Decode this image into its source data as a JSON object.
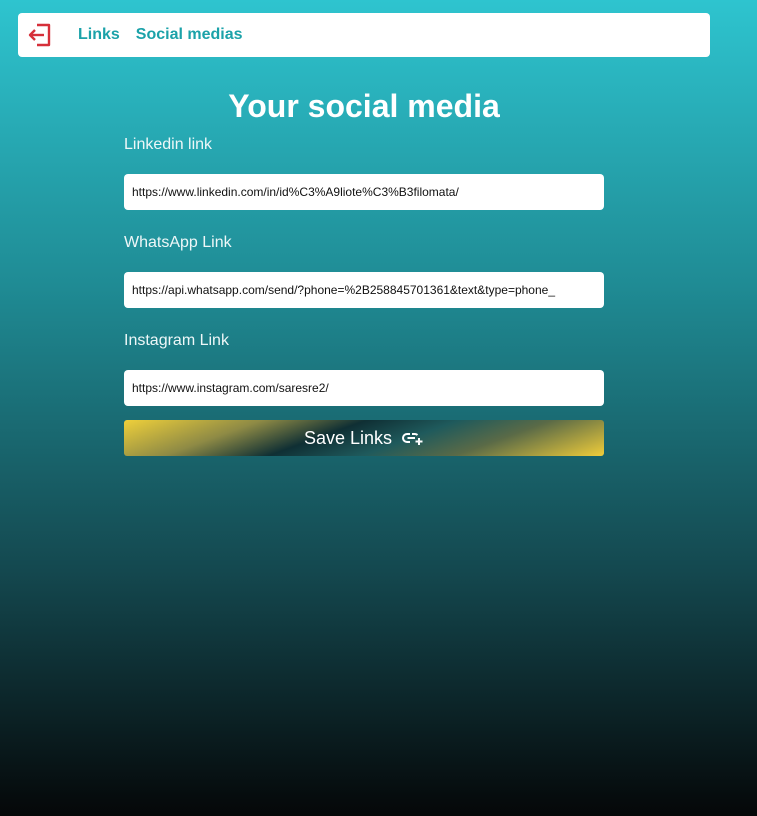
{
  "nav": {
    "logout_icon": "logout-icon",
    "links_label": "Links",
    "social_label": "Social medias",
    "accent_color": "#1ba2a9",
    "logout_color": "#d6303a"
  },
  "page": {
    "title": "Your social media"
  },
  "form": {
    "linkedin": {
      "label": "Linkedin link",
      "value": "https://www.linkedin.com/in/id%C3%A9liote%C3%B3filomata/"
    },
    "whatsapp": {
      "label": "WhatsApp Link",
      "value": "https://api.whatsapp.com/send/?phone=%2B258845701361&text&type=phone_"
    },
    "instagram": {
      "label": "Instagram Link",
      "value": "https://www.instagram.com/saresre2/"
    },
    "save_label": "Save Links",
    "save_icon": "link-add-icon"
  }
}
